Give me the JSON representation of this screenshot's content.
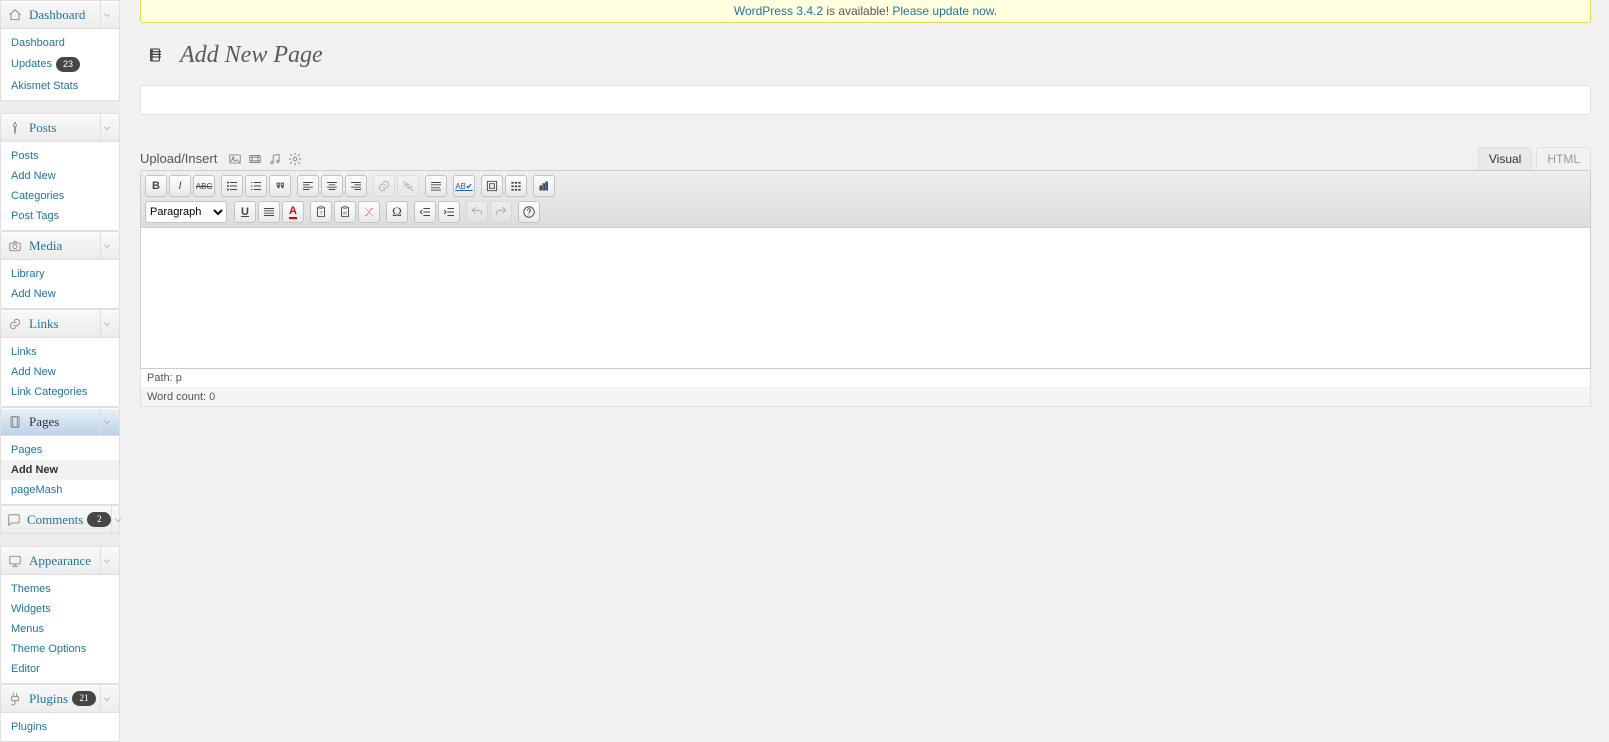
{
  "notice": {
    "link1": "WordPress 3.4.2",
    "mid": " is available! ",
    "link2": "Please update now",
    "tail": "."
  },
  "page": {
    "title": "Add New Page"
  },
  "title_field": {
    "value": "",
    "placeholder": ""
  },
  "media": {
    "label": "Upload/Insert",
    "buttons": [
      "image",
      "video",
      "audio",
      "other"
    ]
  },
  "tabs": {
    "visual": "Visual",
    "html": "HTML",
    "active": "visual"
  },
  "toolbar": {
    "format_select": "Paragraph",
    "row1": [
      "bold",
      "italic",
      "strike",
      "sep",
      "ul",
      "ol",
      "quote",
      "sep",
      "align-left",
      "align-center",
      "align-right",
      "sep",
      "link",
      "unlink",
      "sep",
      "more",
      "sep",
      "spell",
      "sep",
      "fullscreen",
      "kitchen-sink",
      "sep",
      "graph"
    ],
    "row2": [
      "format-select",
      "sep",
      "underline",
      "justify",
      "text-color",
      "sep",
      "paste-text",
      "paste-word",
      "remove-format",
      "sep",
      "char-map",
      "sep",
      "outdent",
      "indent",
      "sep",
      "undo",
      "redo",
      "sep",
      "help"
    ]
  },
  "status": {
    "path_label": "Path: ",
    "path_value": "p",
    "wc_label": "Word count: ",
    "wc_value": "0"
  },
  "menu": [
    {
      "id": "dashboard",
      "label": "Dashboard",
      "icon": "home",
      "items": [
        {
          "id": "dashboard",
          "label": "Dashboard"
        },
        {
          "id": "updates",
          "label": "Updates",
          "badge": "23"
        },
        {
          "id": "akismet",
          "label": "Akismet Stats"
        }
      ]
    },
    {
      "sep": true
    },
    {
      "id": "posts",
      "label": "Posts",
      "icon": "pin",
      "items": [
        {
          "id": "posts",
          "label": "Posts"
        },
        {
          "id": "addnew",
          "label": "Add New"
        },
        {
          "id": "categories",
          "label": "Categories"
        },
        {
          "id": "tags",
          "label": "Post Tags"
        }
      ]
    },
    {
      "id": "media",
      "label": "Media",
      "icon": "camera",
      "items": [
        {
          "id": "library",
          "label": "Library"
        },
        {
          "id": "addnew",
          "label": "Add New"
        }
      ]
    },
    {
      "id": "links",
      "label": "Links",
      "icon": "link",
      "items": [
        {
          "id": "links",
          "label": "Links"
        },
        {
          "id": "addnew",
          "label": "Add New"
        },
        {
          "id": "linkcats",
          "label": "Link Categories"
        }
      ]
    },
    {
      "id": "pages",
      "label": "Pages",
      "icon": "page",
      "current": true,
      "items": [
        {
          "id": "pages",
          "label": "Pages"
        },
        {
          "id": "addnew",
          "label": "Add New",
          "current": true
        },
        {
          "id": "pagemash",
          "label": "pageMash"
        }
      ]
    },
    {
      "id": "comments",
      "label": "Comments",
      "icon": "comment",
      "badge": "2",
      "items": null
    },
    {
      "sep": true
    },
    {
      "id": "appearance",
      "label": "Appearance",
      "icon": "appearance",
      "items": [
        {
          "id": "themes",
          "label": "Themes"
        },
        {
          "id": "widgets",
          "label": "Widgets"
        },
        {
          "id": "menus",
          "label": "Menus"
        },
        {
          "id": "themeopt",
          "label": "Theme Options"
        },
        {
          "id": "editor",
          "label": "Editor"
        }
      ]
    },
    {
      "id": "plugins",
      "label": "Plugins",
      "icon": "plug",
      "badge": "21",
      "items": [
        {
          "id": "plugins",
          "label": "Plugins"
        }
      ]
    }
  ]
}
